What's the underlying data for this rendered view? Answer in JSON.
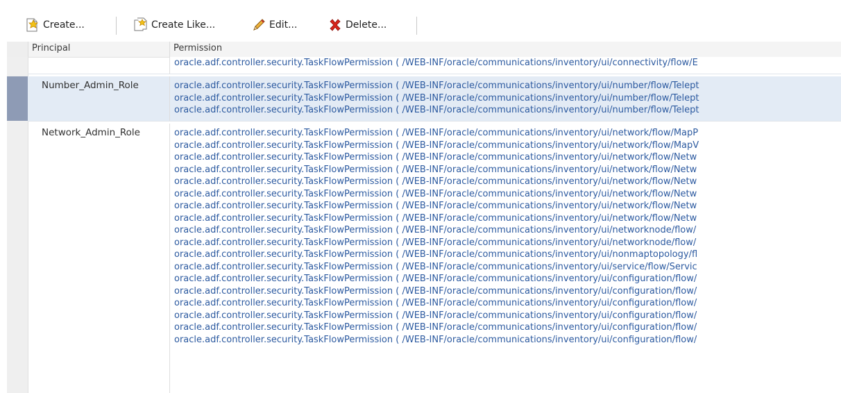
{
  "toolbar": {
    "create_label": "Create...",
    "create_like_label": "Create Like...",
    "edit_label": "Edit...",
    "delete_label": "Delete...",
    "icons": {
      "create": "new-document-icon",
      "create_like": "copy-document-icon",
      "edit": "pencil-icon",
      "delete": "red-x-icon"
    }
  },
  "table": {
    "columns": [
      "Principal",
      "Permission"
    ],
    "rows": [
      {
        "principal": "",
        "permissions": [
          "oracle.adf.controller.security.TaskFlowPermission ( /WEB-INF/oracle/communications/inventory/ui/connectivity/flow/E"
        ]
      },
      {
        "principal": "Number_Admin_Role",
        "selected": true,
        "permissions": [
          "oracle.adf.controller.security.TaskFlowPermission ( /WEB-INF/oracle/communications/inventory/ui/number/flow/Telept",
          "oracle.adf.controller.security.TaskFlowPermission ( /WEB-INF/oracle/communications/inventory/ui/number/flow/Telept",
          "oracle.adf.controller.security.TaskFlowPermission ( /WEB-INF/oracle/communications/inventory/ui/number/flow/Telept"
        ]
      },
      {
        "principal": "Network_Admin_Role",
        "permissions": [
          "oracle.adf.controller.security.TaskFlowPermission ( /WEB-INF/oracle/communications/inventory/ui/network/flow/MapP",
          "oracle.adf.controller.security.TaskFlowPermission ( /WEB-INF/oracle/communications/inventory/ui/network/flow/MapV",
          "oracle.adf.controller.security.TaskFlowPermission ( /WEB-INF/oracle/communications/inventory/ui/network/flow/Netw",
          "oracle.adf.controller.security.TaskFlowPermission ( /WEB-INF/oracle/communications/inventory/ui/network/flow/Netw",
          "oracle.adf.controller.security.TaskFlowPermission ( /WEB-INF/oracle/communications/inventory/ui/network/flow/Netw",
          "oracle.adf.controller.security.TaskFlowPermission ( /WEB-INF/oracle/communications/inventory/ui/network/flow/Netw",
          "oracle.adf.controller.security.TaskFlowPermission ( /WEB-INF/oracle/communications/inventory/ui/network/flow/Netw",
          "oracle.adf.controller.security.TaskFlowPermission ( /WEB-INF/oracle/communications/inventory/ui/network/flow/Netw",
          "oracle.adf.controller.security.TaskFlowPermission ( /WEB-INF/oracle/communications/inventory/ui/networknode/flow/",
          "oracle.adf.controller.security.TaskFlowPermission ( /WEB-INF/oracle/communications/inventory/ui/networknode/flow/",
          "oracle.adf.controller.security.TaskFlowPermission ( /WEB-INF/oracle/communications/inventory/ui/nonmaptopology/fl",
          "oracle.adf.controller.security.TaskFlowPermission ( /WEB-INF/oracle/communications/inventory/ui/service/flow/Servic",
          "oracle.adf.controller.security.TaskFlowPermission ( /WEB-INF/oracle/communications/inventory/ui/configuration/flow/",
          "oracle.adf.controller.security.TaskFlowPermission ( /WEB-INF/oracle/communications/inventory/ui/configuration/flow/",
          "oracle.adf.controller.security.TaskFlowPermission ( /WEB-INF/oracle/communications/inventory/ui/configuration/flow/",
          "oracle.adf.controller.security.TaskFlowPermission ( /WEB-INF/oracle/communications/inventory/ui/configuration/flow/",
          "oracle.adf.controller.security.TaskFlowPermission ( /WEB-INF/oracle/communications/inventory/ui/configuration/flow/",
          "oracle.adf.controller.security.TaskFlowPermission ( /WEB-INF/oracle/communications/inventory/ui/configuration/flow/"
        ]
      }
    ]
  },
  "colors": {
    "link": "#2c5aa0",
    "selected_row": "#e3ebf5",
    "selected_marker": "#8e9bb5",
    "header_bg": "#f4f4f4"
  }
}
